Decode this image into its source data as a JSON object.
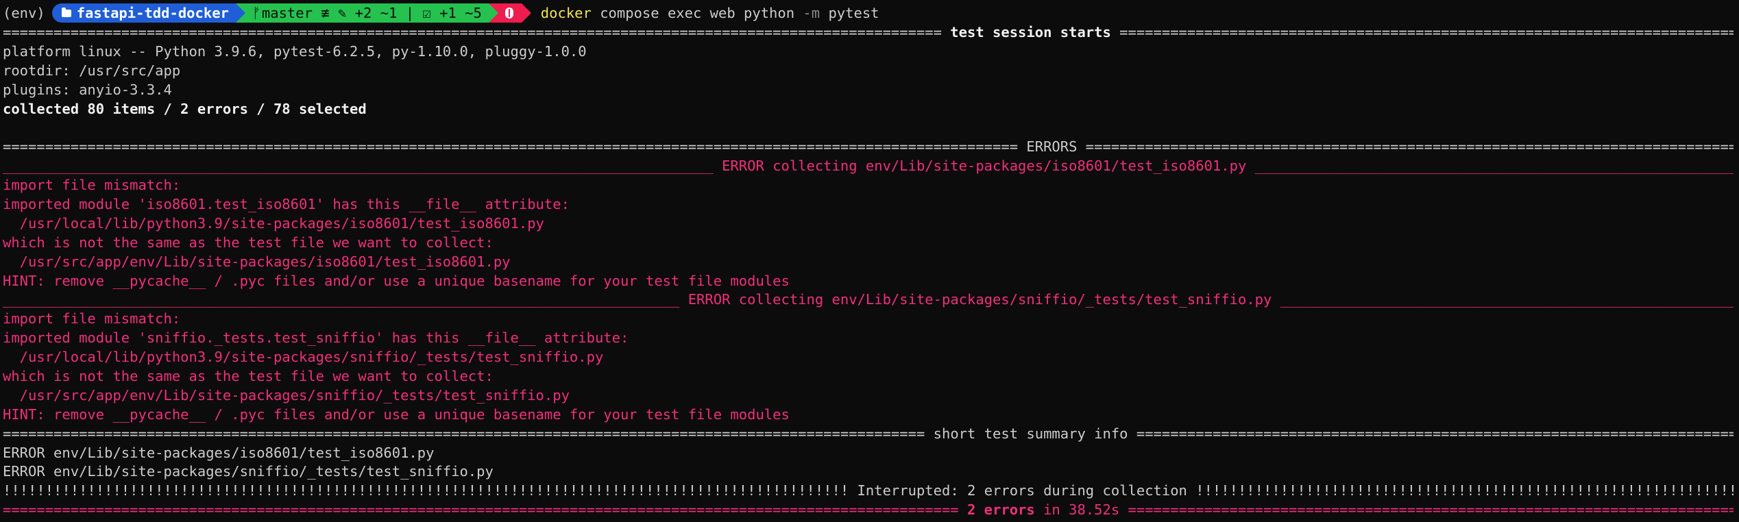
{
  "prompt": {
    "env": "(env)",
    "directory": "fastapi-tdd-docker",
    "git_branch": "master",
    "git_status_1": "≢ ✎ +2 ~1 | ☑ +1 ~5",
    "command": "docker",
    "command_args": " compose exec web python ",
    "command_flag": "-m",
    "command_target": " pytest"
  },
  "session": {
    "header_label": " test session starts ",
    "platform": "platform linux -- Python 3.9.6, pytest-6.2.5, py-1.10.0, pluggy-1.0.0",
    "rootdir": "rootdir: /usr/src/app",
    "plugins": "plugins: anyio-3.3.4",
    "collected": "collected 80 items / 2 errors / 78 selected"
  },
  "errors": {
    "header_label": " ERRORS ",
    "items": [
      {
        "title": " ERROR collecting env/Lib/site-packages/iso8601/test_iso8601.py ",
        "lines": [
          "import file mismatch:",
          "imported module 'iso8601.test_iso8601' has this __file__ attribute:",
          "  /usr/local/lib/python3.9/site-packages/iso8601/test_iso8601.py",
          "which is not the same as the test file we want to collect:",
          "  /usr/src/app/env/Lib/site-packages/iso8601/test_iso8601.py",
          "HINT: remove __pycache__ / .pyc files and/or use a unique basename for your test file modules"
        ]
      },
      {
        "title": " ERROR collecting env/Lib/site-packages/sniffio/_tests/test_sniffio.py ",
        "lines": [
          "import file mismatch:",
          "imported module 'sniffio._tests.test_sniffio' has this __file__ attribute:",
          "  /usr/local/lib/python3.9/site-packages/sniffio/_tests/test_sniffio.py",
          "which is not the same as the test file we want to collect:",
          "  /usr/src/app/env/Lib/site-packages/sniffio/_tests/test_sniffio.py",
          "HINT: remove __pycache__ / .pyc files and/or use a unique basename for your test file modules"
        ]
      }
    ]
  },
  "summary": {
    "header_label": " short test summary info ",
    "lines": [
      "ERROR env/Lib/site-packages/iso8601/test_iso8601.py",
      "ERROR env/Lib/site-packages/sniffio/_tests/test_sniffio.py"
    ],
    "interrupted_label": " Interrupted: 2 errors during collection ",
    "final_errors": "2 errors",
    "final_time": " in 38.52s "
  },
  "colors": {
    "background": "#0c0c0c",
    "error_red": "#f0307a",
    "prompt_blue": "#1f5ed6",
    "prompt_green": "#25c24f",
    "prompt_red": "#ee1d4e",
    "command_yellow": "#f2e54f"
  }
}
